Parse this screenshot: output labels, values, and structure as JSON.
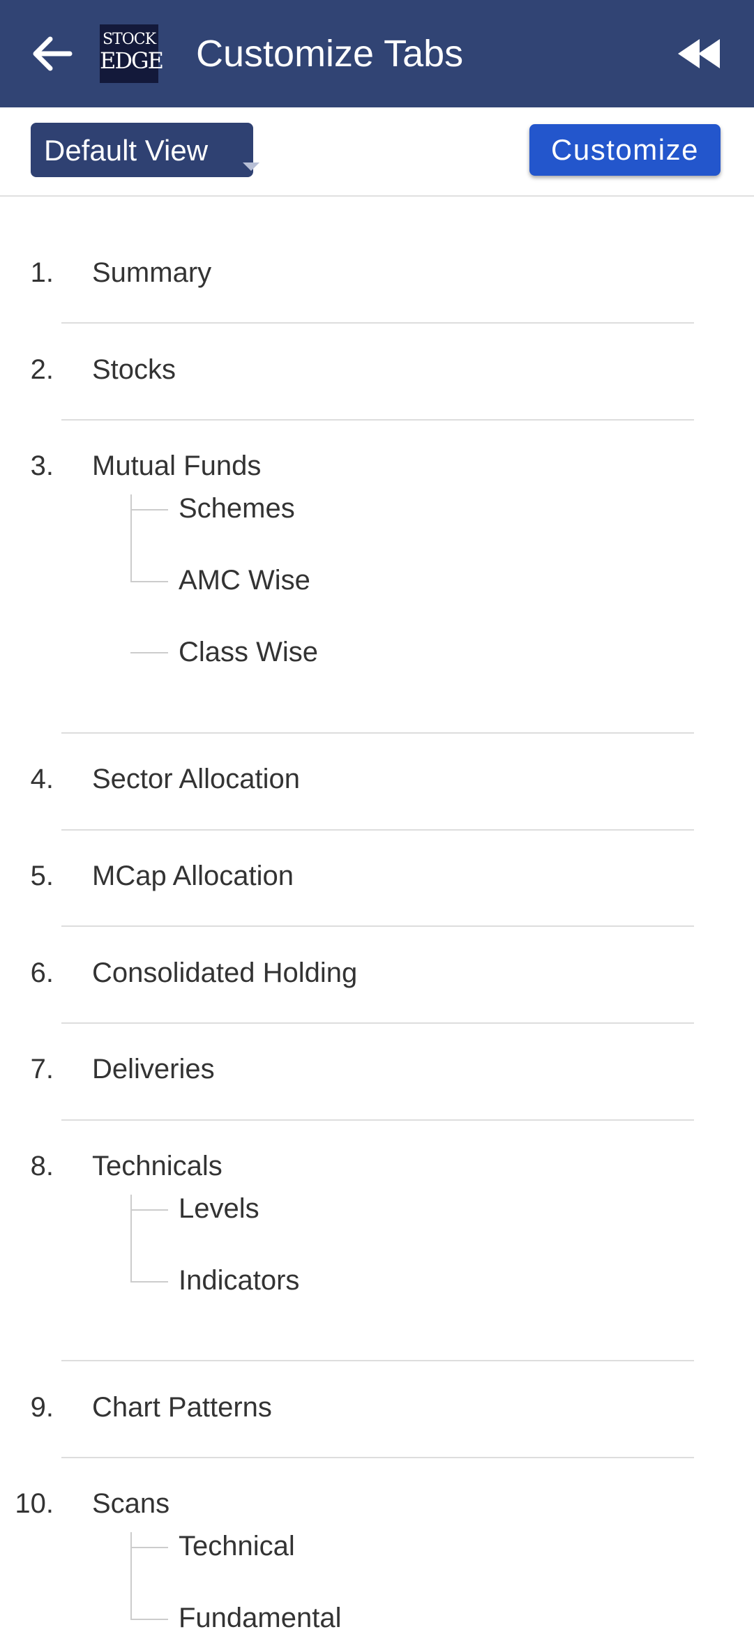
{
  "header": {
    "title": "Customize Tabs",
    "back_icon": "arrow-left-icon",
    "collapse_icon": "double-chevron-left-icon",
    "logo": {
      "line1": "STOCK",
      "line2": "EDGE"
    },
    "colors": {
      "bar": "#314474",
      "logo_bg": "#13193a"
    }
  },
  "toolbar": {
    "view_select": {
      "value": "Default View",
      "icon": "caret-down-icon"
    },
    "customize_label": "Customize",
    "colors": {
      "select_bg": "#2f4172",
      "customize_bg": "#2356cc"
    }
  },
  "tabs": [
    {
      "number": "1.",
      "label": "Summary",
      "children": []
    },
    {
      "number": "2.",
      "label": "Stocks",
      "children": []
    },
    {
      "number": "3.",
      "label": "Mutual Funds",
      "children": [
        "Schemes",
        "AMC Wise",
        "Class Wise"
      ]
    },
    {
      "number": "4.",
      "label": "Sector Allocation",
      "children": []
    },
    {
      "number": "5.",
      "label": "MCap Allocation",
      "children": []
    },
    {
      "number": "6.",
      "label": "Consolidated Holding",
      "children": []
    },
    {
      "number": "7.",
      "label": "Deliveries",
      "children": []
    },
    {
      "number": "8.",
      "label": "Technicals",
      "children": [
        "Levels",
        "Indicators"
      ]
    },
    {
      "number": "9.",
      "label": "Chart Patterns",
      "children": []
    },
    {
      "number": "10.",
      "label": "Scans",
      "children": [
        "Technical",
        "Fundamental"
      ]
    }
  ]
}
